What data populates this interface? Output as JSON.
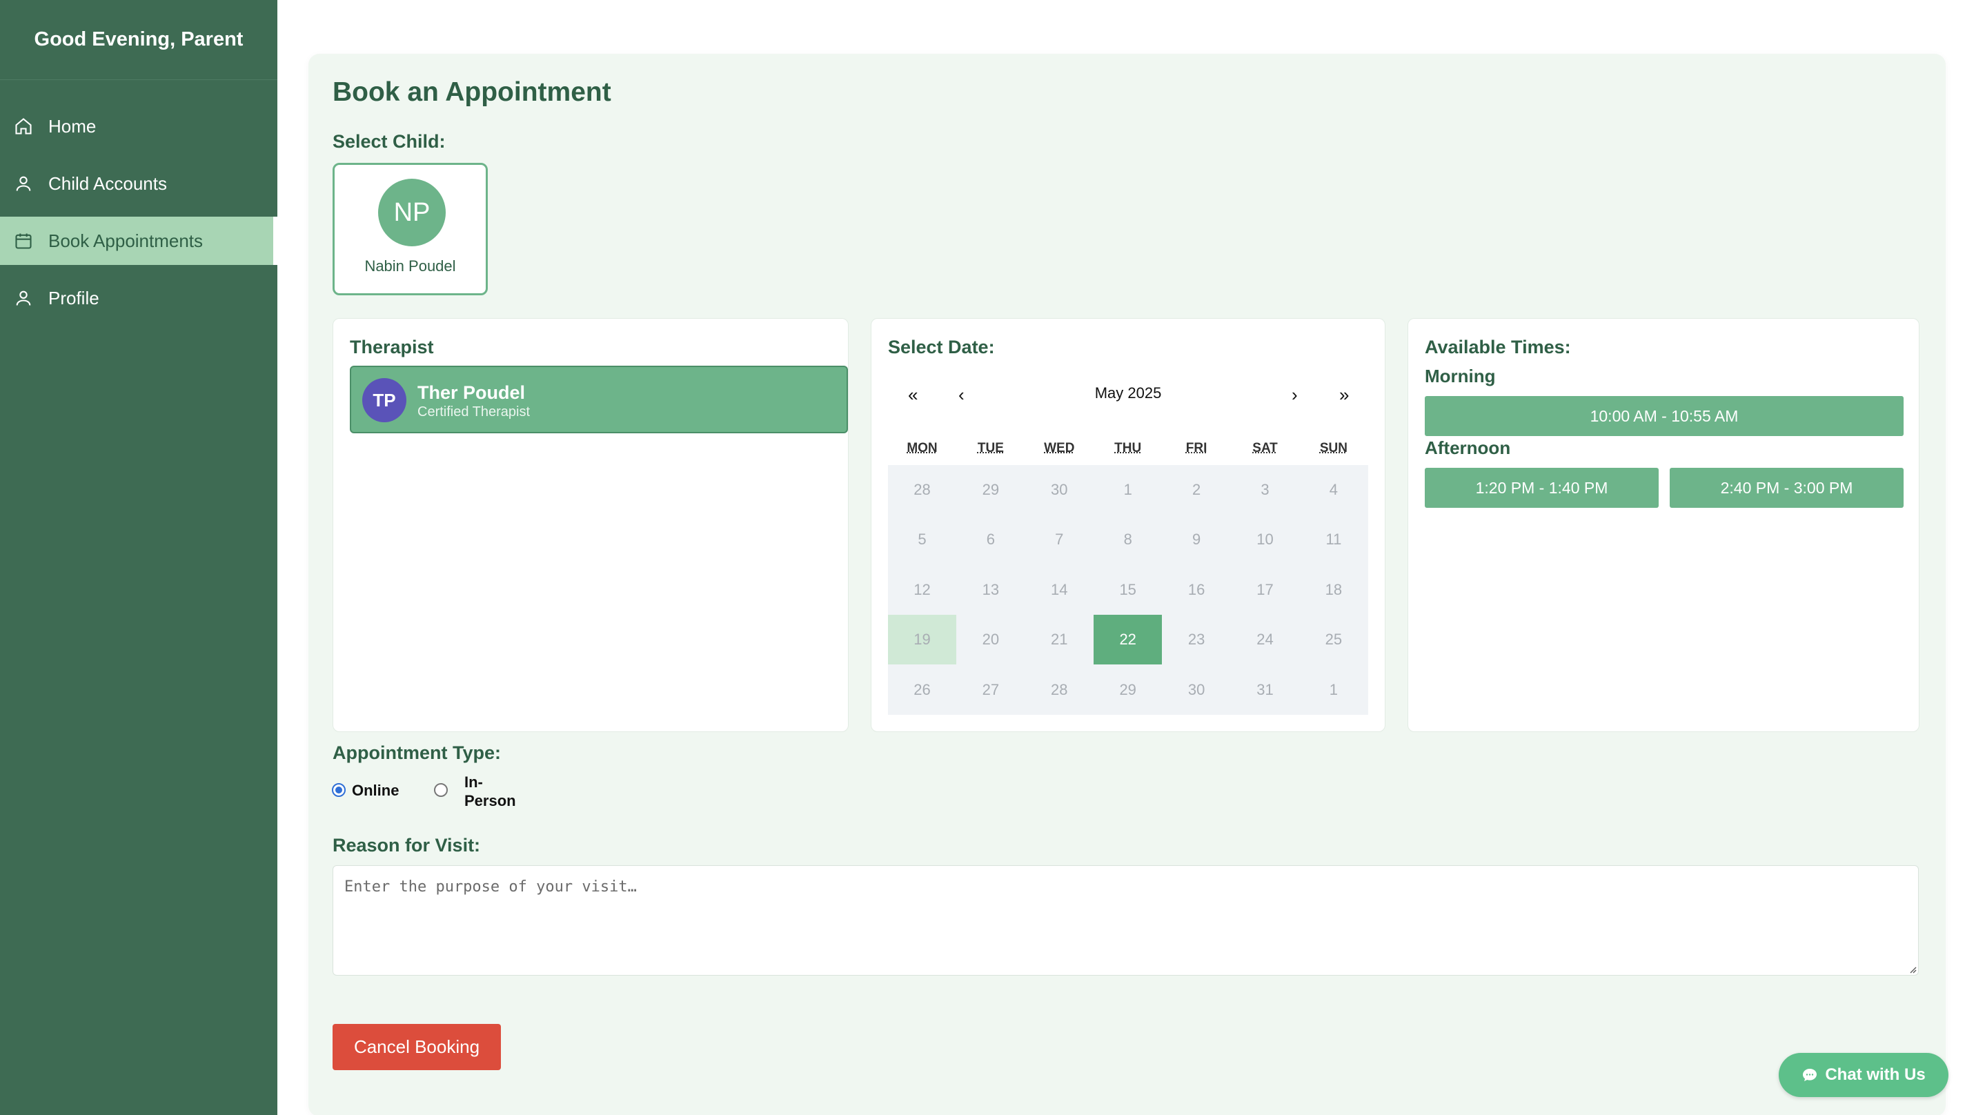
{
  "sidebar": {
    "greeting": "Good Evening, Parent",
    "items": [
      {
        "label": "Home",
        "icon": "home-icon"
      },
      {
        "label": "Child Accounts",
        "icon": "user-icon"
      },
      {
        "label": "Book Appointments",
        "icon": "calendar-icon",
        "active": true
      },
      {
        "label": "Profile",
        "icon": "user-icon"
      }
    ]
  },
  "main": {
    "title": "Book an Appointment",
    "select_child_label": "Select Child:",
    "child": {
      "initials": "NP",
      "name": "Nabin Poudel"
    },
    "therapist": {
      "title": "Therapist",
      "initials": "TP",
      "name": "Ther Poudel",
      "role": "Certified Therapist"
    },
    "calendar": {
      "title": "Select Date:",
      "month": "May 2025",
      "nav": {
        "prev_year": "«",
        "prev_month": "‹",
        "next_month": "›",
        "next_year": "»"
      },
      "weekdays": [
        "MON",
        "TUE",
        "WED",
        "THU",
        "FRI",
        "SAT",
        "SUN"
      ],
      "weeks": [
        [
          "28",
          "29",
          "30",
          "1",
          "2",
          "3",
          "4"
        ],
        [
          "5",
          "6",
          "7",
          "8",
          "9",
          "10",
          "11"
        ],
        [
          "12",
          "13",
          "14",
          "15",
          "16",
          "17",
          "18"
        ],
        [
          "19",
          "20",
          "21",
          "22",
          "23",
          "24",
          "25"
        ],
        [
          "26",
          "27",
          "28",
          "29",
          "30",
          "31",
          "1"
        ]
      ],
      "today": "19",
      "selected": "22"
    },
    "times": {
      "title": "Available Times:",
      "morning_label": "Morning",
      "morning": [
        "10:00 AM - 10:55 AM"
      ],
      "afternoon_label": "Afternoon",
      "afternoon": [
        "1:20 PM - 1:40 PM",
        "2:40 PM - 3:00 PM"
      ]
    },
    "appointment_type": {
      "label": "Appointment Type:",
      "options": [
        "Online",
        "In-\nPerson"
      ],
      "selected": "Online"
    },
    "reason": {
      "label": "Reason for Visit:",
      "placeholder": "Enter the purpose of your visit…"
    },
    "cancel_label": "Cancel Booking",
    "chat_label": "Chat with Us"
  },
  "colors": {
    "sidebar": "#3e6b53",
    "accent": "#6db48a",
    "active_nav": "#a8d5b4",
    "danger": "#dc4d3c",
    "chat": "#5dc08a",
    "therapist_avatar": "#5a53b8"
  }
}
